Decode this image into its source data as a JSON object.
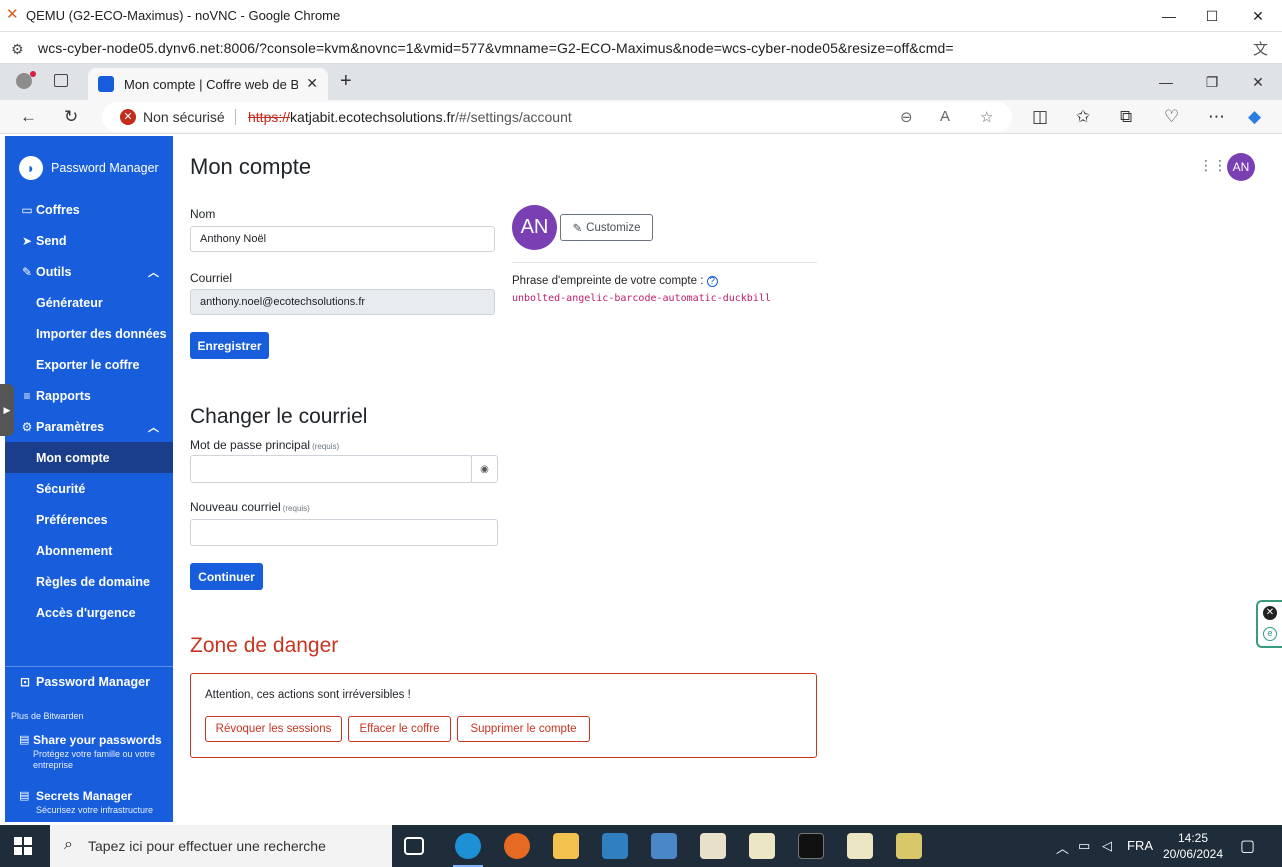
{
  "outer_window": {
    "title": "QEMU (G2-ECO-Maximus) - noVNC - Google Chrome",
    "url": "wcs-cyber-node05.dynv6.net:8006/?console=kvm&novnc=1&vmid=577&vmname=G2-ECO-Maximus&node=wcs-cyber-node05&resize=off&cmd="
  },
  "inner_browser": {
    "tab_title": "Mon compte | Coffre web de Bitwarden",
    "security_label": "Non sécurisé",
    "url_scheme": "https://",
    "url_host": "katjabit.ecotechsolutions.fr",
    "url_path": "/#/settings/account"
  },
  "sidebar": {
    "brand": "Password Manager",
    "items": [
      {
        "label": "Coffres",
        "icon": "vault-icon"
      },
      {
        "label": "Send",
        "icon": "send-icon"
      },
      {
        "label": "Outils",
        "icon": "wrench-icon",
        "expanded": true
      },
      {
        "label": "Générateur"
      },
      {
        "label": "Importer des données"
      },
      {
        "label": "Exporter le coffre"
      },
      {
        "label": "Rapports",
        "icon": "reports-icon"
      },
      {
        "label": "Paramètres",
        "icon": "gear-icon",
        "expanded": true
      },
      {
        "label": "Mon compte",
        "active": true
      },
      {
        "label": "Sécurité"
      },
      {
        "label": "Préférences"
      },
      {
        "label": "Abonnement"
      },
      {
        "label": "Règles de domaine"
      },
      {
        "label": "Accès d'urgence"
      }
    ],
    "product_switch": "Password Manager",
    "more_label": "Plus de Bitwarden",
    "promos": [
      {
        "title": "Share your passwords",
        "desc": "Protégez votre famille ou votre entreprise"
      },
      {
        "title": "Secrets Manager",
        "desc": "Sécurisez votre infrastructure"
      }
    ]
  },
  "header": {
    "avatar_initials": "AN"
  },
  "account": {
    "title": "Mon compte",
    "name_label": "Nom",
    "name_value": "Anthony Noël",
    "email_label": "Courriel",
    "email_value": "anthony.noel@ecotechsolutions.fr",
    "save_button": "Enregistrer",
    "avatar_initials": "AN",
    "customize_button": "Customize",
    "fingerprint_label": "Phrase d'empreinte de votre compte :",
    "fingerprint_value": "unbolted-angelic-barcode-automatic-duckbill"
  },
  "change_email": {
    "title": "Changer le courriel",
    "password_label": "Mot de passe principal",
    "required": "(requis)",
    "new_email_label": "Nouveau courriel",
    "continue_button": "Continuer"
  },
  "danger": {
    "title": "Zone de danger",
    "warning": "Attention, ces actions sont irréversibles !",
    "buttons": [
      "Révoquer les sessions",
      "Effacer le coffre",
      "Supprimer le compte"
    ]
  },
  "taskbar": {
    "search_placeholder": "Tapez ici pour effectuer une recherche",
    "language": "FRA",
    "time": "14:25",
    "date": "20/06/2024"
  },
  "colors": {
    "brand": "#175ddc",
    "danger": "#c83522",
    "avatar": "#7b3fb4"
  }
}
